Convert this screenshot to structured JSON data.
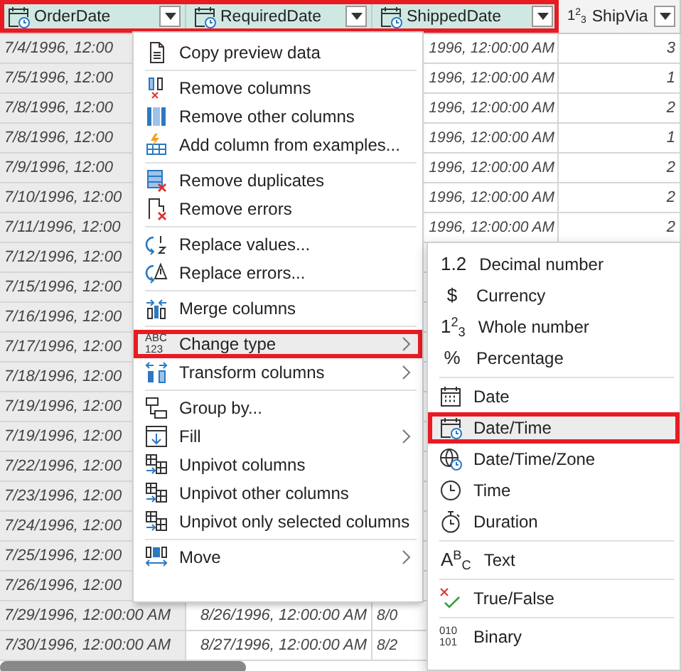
{
  "columns": [
    {
      "title": "OrderDate",
      "selected": true
    },
    {
      "title": "RequiredDate",
      "selected": true
    },
    {
      "title": "ShippedDate",
      "selected": true
    },
    {
      "title": "ShipVia",
      "selected": false,
      "glyph": "1$^{2}$$_{3}$"
    }
  ],
  "rows": [
    {
      "order_date": "7/4/1996, 12:00",
      "shipped_date": "1996, 12:00:00 AM",
      "ship_via": "3"
    },
    {
      "order_date": "7/5/1996, 12:00",
      "shipped_date": "1996, 12:00:00 AM",
      "ship_via": "1"
    },
    {
      "order_date": "7/8/1996, 12:00",
      "shipped_date": "1996, 12:00:00 AM",
      "ship_via": "2"
    },
    {
      "order_date": "7/8/1996, 12:00",
      "shipped_date": "1996, 12:00:00 AM",
      "ship_via": "1"
    },
    {
      "order_date": "7/9/1996, 12:00",
      "shipped_date": "1996, 12:00:00 AM",
      "ship_via": "2"
    },
    {
      "order_date": "7/10/1996, 12:00",
      "shipped_date": "1996, 12:00:00 AM",
      "ship_via": "2"
    },
    {
      "order_date": "7/11/1996, 12:00",
      "shipped_date": "1996, 12:00:00 AM",
      "ship_via": "2"
    },
    {
      "order_date": "7/12/1996, 12:00"
    },
    {
      "order_date": "7/15/1996, 12:00"
    },
    {
      "order_date": "7/16/1996, 12:00"
    },
    {
      "order_date": "7/17/1996, 12:00"
    },
    {
      "order_date": "7/18/1996, 12:00"
    },
    {
      "order_date": "7/19/1996, 12:00"
    },
    {
      "order_date": "7/19/1996, 12:00"
    },
    {
      "order_date": "7/22/1996, 12:00"
    },
    {
      "order_date": "7/23/1996, 12:00"
    },
    {
      "order_date": "7/24/1996, 12:00"
    },
    {
      "order_date": "7/25/1996, 12:00"
    },
    {
      "order_date": "7/26/1996, 12:00"
    },
    {
      "order_date": "7/29/1996, 12:00:00 AM",
      "required_date": "8/26/1996, 12:00:00 AM",
      "shipped_date": "8/0"
    },
    {
      "order_date": "7/30/1996, 12:00:00 AM",
      "required_date": "8/27/1996, 12:00:00 AM",
      "shipped_date": "8/2"
    }
  ],
  "menu": {
    "groups": [
      [
        {
          "label": "Copy preview data",
          "selected": false,
          "submenu": false
        }
      ],
      [
        {
          "label": "Remove columns",
          "selected": false,
          "submenu": false
        },
        {
          "label": "Remove other columns",
          "selected": false,
          "submenu": false
        },
        {
          "label": "Add column from examples...",
          "selected": false,
          "submenu": false
        }
      ],
      [
        {
          "label": "Remove duplicates",
          "selected": false,
          "submenu": false
        },
        {
          "label": "Remove errors",
          "selected": false,
          "submenu": false
        }
      ],
      [
        {
          "label": "Replace values...",
          "selected": false,
          "submenu": false
        },
        {
          "label": "Replace errors...",
          "selected": false,
          "submenu": false
        }
      ],
      [
        {
          "label": "Merge columns",
          "selected": false,
          "submenu": false
        }
      ],
      [
        {
          "label": "Change type",
          "selected": true,
          "submenu": true,
          "glyph_lines": [
            "ABC",
            "123"
          ]
        },
        {
          "label": "Transform columns",
          "selected": false,
          "submenu": true
        }
      ],
      [
        {
          "label": "Group by...",
          "selected": false,
          "submenu": false
        },
        {
          "label": "Fill",
          "selected": false,
          "submenu": true
        },
        {
          "label": "Unpivot columns",
          "selected": false,
          "submenu": false
        },
        {
          "label": "Unpivot other columns",
          "selected": false,
          "submenu": false
        },
        {
          "label": "Unpivot only selected columns",
          "selected": false,
          "submenu": false
        }
      ],
      [
        {
          "label": "Move",
          "selected": false,
          "submenu": true
        }
      ]
    ]
  },
  "submenu": {
    "groups": [
      [
        {
          "label": "Decimal number",
          "selected": false,
          "glyph": "1.2"
        },
        {
          "label": "Currency",
          "selected": false,
          "glyph": "$"
        },
        {
          "label": "Whole number",
          "selected": false,
          "glyph": "1$^{2}$$_{3}$"
        },
        {
          "label": "Percentage",
          "selected": false,
          "glyph": "%"
        }
      ],
      [
        {
          "label": "Date",
          "selected": false
        },
        {
          "label": "Date/Time",
          "selected": true
        },
        {
          "label": "Date/Time/Zone",
          "selected": false
        },
        {
          "label": "Time",
          "selected": false
        },
        {
          "label": "Duration",
          "selected": false
        }
      ],
      [
        {
          "label": "Text",
          "selected": false,
          "glyph": "A$^{B}$$_{C}$"
        }
      ],
      [
        {
          "label": "True/False",
          "selected": false
        }
      ],
      [
        {
          "label": "Binary",
          "selected": false,
          "glyph_lines": [
            "010",
            "101"
          ]
        }
      ]
    ]
  }
}
